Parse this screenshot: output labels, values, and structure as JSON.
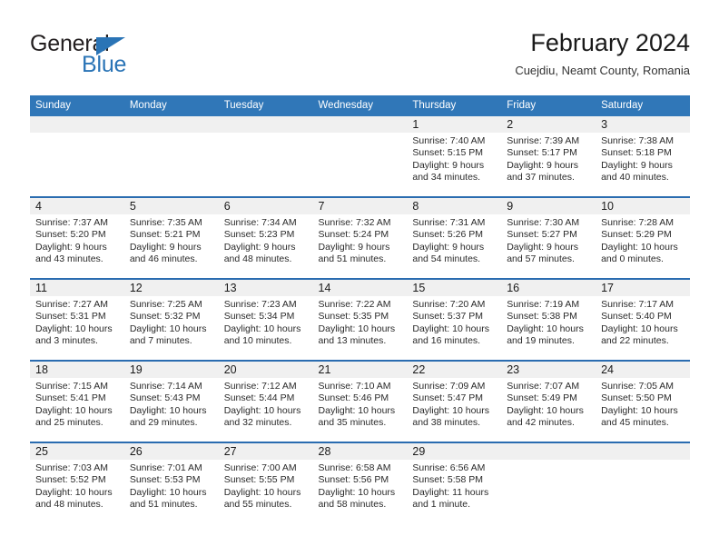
{
  "brand": {
    "name_part1": "General",
    "name_part2": "Blue",
    "triangle_icon": "blue-triangle-icon",
    "accent_color": "#2a74b6"
  },
  "header": {
    "title": "February 2024",
    "location": "Cuejdiu, Neamt County, Romania"
  },
  "colors": {
    "header_blue": "#3077b8",
    "row_rule_blue": "#2a6cb0",
    "daynum_band": "#f0f0f0",
    "text": "#222222"
  },
  "weekday_headers": [
    "Sunday",
    "Monday",
    "Tuesday",
    "Wednesday",
    "Thursday",
    "Friday",
    "Saturday"
  ],
  "weeks": [
    [
      {
        "day": "",
        "sunrise": "",
        "sunset": "",
        "daylight_line1": "",
        "daylight_line2": ""
      },
      {
        "day": "",
        "sunrise": "",
        "sunset": "",
        "daylight_line1": "",
        "daylight_line2": ""
      },
      {
        "day": "",
        "sunrise": "",
        "sunset": "",
        "daylight_line1": "",
        "daylight_line2": ""
      },
      {
        "day": "",
        "sunrise": "",
        "sunset": "",
        "daylight_line1": "",
        "daylight_line2": ""
      },
      {
        "day": "1",
        "sunrise": "Sunrise: 7:40 AM",
        "sunset": "Sunset: 5:15 PM",
        "daylight_line1": "Daylight: 9 hours",
        "daylight_line2": "and 34 minutes."
      },
      {
        "day": "2",
        "sunrise": "Sunrise: 7:39 AM",
        "sunset": "Sunset: 5:17 PM",
        "daylight_line1": "Daylight: 9 hours",
        "daylight_line2": "and 37 minutes."
      },
      {
        "day": "3",
        "sunrise": "Sunrise: 7:38 AM",
        "sunset": "Sunset: 5:18 PM",
        "daylight_line1": "Daylight: 9 hours",
        "daylight_line2": "and 40 minutes."
      }
    ],
    [
      {
        "day": "4",
        "sunrise": "Sunrise: 7:37 AM",
        "sunset": "Sunset: 5:20 PM",
        "daylight_line1": "Daylight: 9 hours",
        "daylight_line2": "and 43 minutes."
      },
      {
        "day": "5",
        "sunrise": "Sunrise: 7:35 AM",
        "sunset": "Sunset: 5:21 PM",
        "daylight_line1": "Daylight: 9 hours",
        "daylight_line2": "and 46 minutes."
      },
      {
        "day": "6",
        "sunrise": "Sunrise: 7:34 AM",
        "sunset": "Sunset: 5:23 PM",
        "daylight_line1": "Daylight: 9 hours",
        "daylight_line2": "and 48 minutes."
      },
      {
        "day": "7",
        "sunrise": "Sunrise: 7:32 AM",
        "sunset": "Sunset: 5:24 PM",
        "daylight_line1": "Daylight: 9 hours",
        "daylight_line2": "and 51 minutes."
      },
      {
        "day": "8",
        "sunrise": "Sunrise: 7:31 AM",
        "sunset": "Sunset: 5:26 PM",
        "daylight_line1": "Daylight: 9 hours",
        "daylight_line2": "and 54 minutes."
      },
      {
        "day": "9",
        "sunrise": "Sunrise: 7:30 AM",
        "sunset": "Sunset: 5:27 PM",
        "daylight_line1": "Daylight: 9 hours",
        "daylight_line2": "and 57 minutes."
      },
      {
        "day": "10",
        "sunrise": "Sunrise: 7:28 AM",
        "sunset": "Sunset: 5:29 PM",
        "daylight_line1": "Daylight: 10 hours",
        "daylight_line2": "and 0 minutes."
      }
    ],
    [
      {
        "day": "11",
        "sunrise": "Sunrise: 7:27 AM",
        "sunset": "Sunset: 5:31 PM",
        "daylight_line1": "Daylight: 10 hours",
        "daylight_line2": "and 3 minutes."
      },
      {
        "day": "12",
        "sunrise": "Sunrise: 7:25 AM",
        "sunset": "Sunset: 5:32 PM",
        "daylight_line1": "Daylight: 10 hours",
        "daylight_line2": "and 7 minutes."
      },
      {
        "day": "13",
        "sunrise": "Sunrise: 7:23 AM",
        "sunset": "Sunset: 5:34 PM",
        "daylight_line1": "Daylight: 10 hours",
        "daylight_line2": "and 10 minutes."
      },
      {
        "day": "14",
        "sunrise": "Sunrise: 7:22 AM",
        "sunset": "Sunset: 5:35 PM",
        "daylight_line1": "Daylight: 10 hours",
        "daylight_line2": "and 13 minutes."
      },
      {
        "day": "15",
        "sunrise": "Sunrise: 7:20 AM",
        "sunset": "Sunset: 5:37 PM",
        "daylight_line1": "Daylight: 10 hours",
        "daylight_line2": "and 16 minutes."
      },
      {
        "day": "16",
        "sunrise": "Sunrise: 7:19 AM",
        "sunset": "Sunset: 5:38 PM",
        "daylight_line1": "Daylight: 10 hours",
        "daylight_line2": "and 19 minutes."
      },
      {
        "day": "17",
        "sunrise": "Sunrise: 7:17 AM",
        "sunset": "Sunset: 5:40 PM",
        "daylight_line1": "Daylight: 10 hours",
        "daylight_line2": "and 22 minutes."
      }
    ],
    [
      {
        "day": "18",
        "sunrise": "Sunrise: 7:15 AM",
        "sunset": "Sunset: 5:41 PM",
        "daylight_line1": "Daylight: 10 hours",
        "daylight_line2": "and 25 minutes."
      },
      {
        "day": "19",
        "sunrise": "Sunrise: 7:14 AM",
        "sunset": "Sunset: 5:43 PM",
        "daylight_line1": "Daylight: 10 hours",
        "daylight_line2": "and 29 minutes."
      },
      {
        "day": "20",
        "sunrise": "Sunrise: 7:12 AM",
        "sunset": "Sunset: 5:44 PM",
        "daylight_line1": "Daylight: 10 hours",
        "daylight_line2": "and 32 minutes."
      },
      {
        "day": "21",
        "sunrise": "Sunrise: 7:10 AM",
        "sunset": "Sunset: 5:46 PM",
        "daylight_line1": "Daylight: 10 hours",
        "daylight_line2": "and 35 minutes."
      },
      {
        "day": "22",
        "sunrise": "Sunrise: 7:09 AM",
        "sunset": "Sunset: 5:47 PM",
        "daylight_line1": "Daylight: 10 hours",
        "daylight_line2": "and 38 minutes."
      },
      {
        "day": "23",
        "sunrise": "Sunrise: 7:07 AM",
        "sunset": "Sunset: 5:49 PM",
        "daylight_line1": "Daylight: 10 hours",
        "daylight_line2": "and 42 minutes."
      },
      {
        "day": "24",
        "sunrise": "Sunrise: 7:05 AM",
        "sunset": "Sunset: 5:50 PM",
        "daylight_line1": "Daylight: 10 hours",
        "daylight_line2": "and 45 minutes."
      }
    ],
    [
      {
        "day": "25",
        "sunrise": "Sunrise: 7:03 AM",
        "sunset": "Sunset: 5:52 PM",
        "daylight_line1": "Daylight: 10 hours",
        "daylight_line2": "and 48 minutes."
      },
      {
        "day": "26",
        "sunrise": "Sunrise: 7:01 AM",
        "sunset": "Sunset: 5:53 PM",
        "daylight_line1": "Daylight: 10 hours",
        "daylight_line2": "and 51 minutes."
      },
      {
        "day": "27",
        "sunrise": "Sunrise: 7:00 AM",
        "sunset": "Sunset: 5:55 PM",
        "daylight_line1": "Daylight: 10 hours",
        "daylight_line2": "and 55 minutes."
      },
      {
        "day": "28",
        "sunrise": "Sunrise: 6:58 AM",
        "sunset": "Sunset: 5:56 PM",
        "daylight_line1": "Daylight: 10 hours",
        "daylight_line2": "and 58 minutes."
      },
      {
        "day": "29",
        "sunrise": "Sunrise: 6:56 AM",
        "sunset": "Sunset: 5:58 PM",
        "daylight_line1": "Daylight: 11 hours",
        "daylight_line2": "and 1 minute."
      },
      {
        "day": "",
        "sunrise": "",
        "sunset": "",
        "daylight_line1": "",
        "daylight_line2": ""
      },
      {
        "day": "",
        "sunrise": "",
        "sunset": "",
        "daylight_line1": "",
        "daylight_line2": ""
      }
    ]
  ]
}
